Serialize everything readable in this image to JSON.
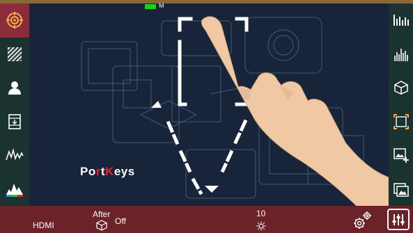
{
  "status": {
    "battery_label": "M",
    "battery_color": "#1fd11f"
  },
  "logo": {
    "part1": "Po",
    "accent": "r",
    "part2": "t",
    "accent2": "K",
    "part3": "eys"
  },
  "left_sidebar": {
    "items": [
      {
        "name": "focus-assist",
        "icon": "target-icon",
        "active": true
      },
      {
        "name": "zebra",
        "icon": "zebra-stripes-icon",
        "active": false
      },
      {
        "name": "skin-tone",
        "icon": "person-icon",
        "active": false
      },
      {
        "name": "frame-guide",
        "icon": "frame-guide-icon",
        "active": false
      },
      {
        "name": "waveform",
        "icon": "waveform-icon",
        "active": false
      },
      {
        "name": "histogram",
        "icon": "histogram-icon",
        "active": false
      }
    ]
  },
  "right_sidebar": {
    "items": [
      {
        "name": "vectorscope",
        "icon": "bars-icon"
      },
      {
        "name": "rgb-parade",
        "icon": "parade-icon"
      },
      {
        "name": "lut-3d",
        "icon": "cube-icon"
      },
      {
        "name": "crop",
        "icon": "crop-icon"
      },
      {
        "name": "image-overlay",
        "icon": "image-add-icon"
      },
      {
        "name": "gallery",
        "icon": "gallery-icon"
      }
    ]
  },
  "bottom_bar": {
    "input": "HDMI",
    "lut_label": "After",
    "lut_value": "Off",
    "brightness_value": "10",
    "accent_color": "#6b2229"
  }
}
